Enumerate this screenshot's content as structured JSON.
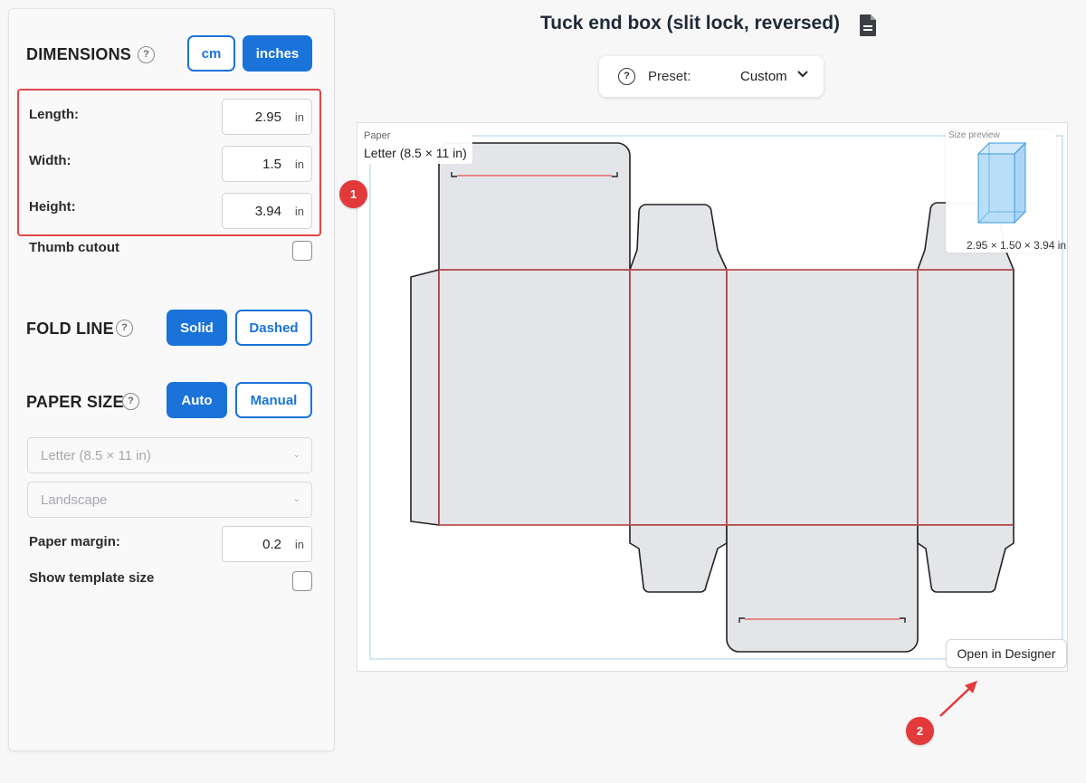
{
  "sidebar": {
    "dimensions": {
      "title": "DIMENSIONS",
      "help": "?",
      "unit_options": [
        "cm",
        "inches"
      ],
      "active_unit": "inches",
      "fields": [
        {
          "label": "Length:",
          "value": "2.95",
          "unit": "in"
        },
        {
          "label": "Width:",
          "value": "1.5",
          "unit": "in"
        },
        {
          "label": "Height:",
          "value": "3.94",
          "unit": "in"
        }
      ],
      "thumb_cutout": {
        "label": "Thumb cutout",
        "checked": false
      }
    },
    "fold_line": {
      "title": "FOLD LINE",
      "help": "?",
      "options": [
        "Solid",
        "Dashed"
      ],
      "active": "Solid"
    },
    "paper_size": {
      "title": "PAPER SIZE",
      "help": "?",
      "options": [
        "Auto",
        "Manual"
      ],
      "active": "Auto",
      "paper_select": "Letter (8.5 × 11 in)",
      "orientation_select": "Landscape",
      "margin": {
        "label": "Paper margin:",
        "value": "0.2",
        "unit": "in"
      },
      "show_template_size": {
        "label": "Show template size",
        "checked": false
      }
    }
  },
  "main": {
    "title": "Tuck end box (slit lock, reversed)",
    "preset": {
      "help": "?",
      "label": "Preset:",
      "value": "Custom"
    },
    "paper_label": {
      "caption": "Paper",
      "value": "Letter (8.5 × 11 in)"
    },
    "size_preview": {
      "title": "Size preview",
      "dims": "2.95 × 1.50 × 3.94 in"
    },
    "open_designer": "Open in Designer"
  },
  "annotations": {
    "marker1": "1",
    "marker2": "2"
  },
  "colors": {
    "accent": "#1a73d9",
    "highlight": "#e04646",
    "fold_line": "#e55050",
    "cut_line": "#222222",
    "panel_fill": "#e4e5e9",
    "preview_box": "#7fc3f3"
  },
  "icons": [
    "help-icon",
    "document-icon",
    "chevron-down-icon",
    "arrow-icon"
  ]
}
